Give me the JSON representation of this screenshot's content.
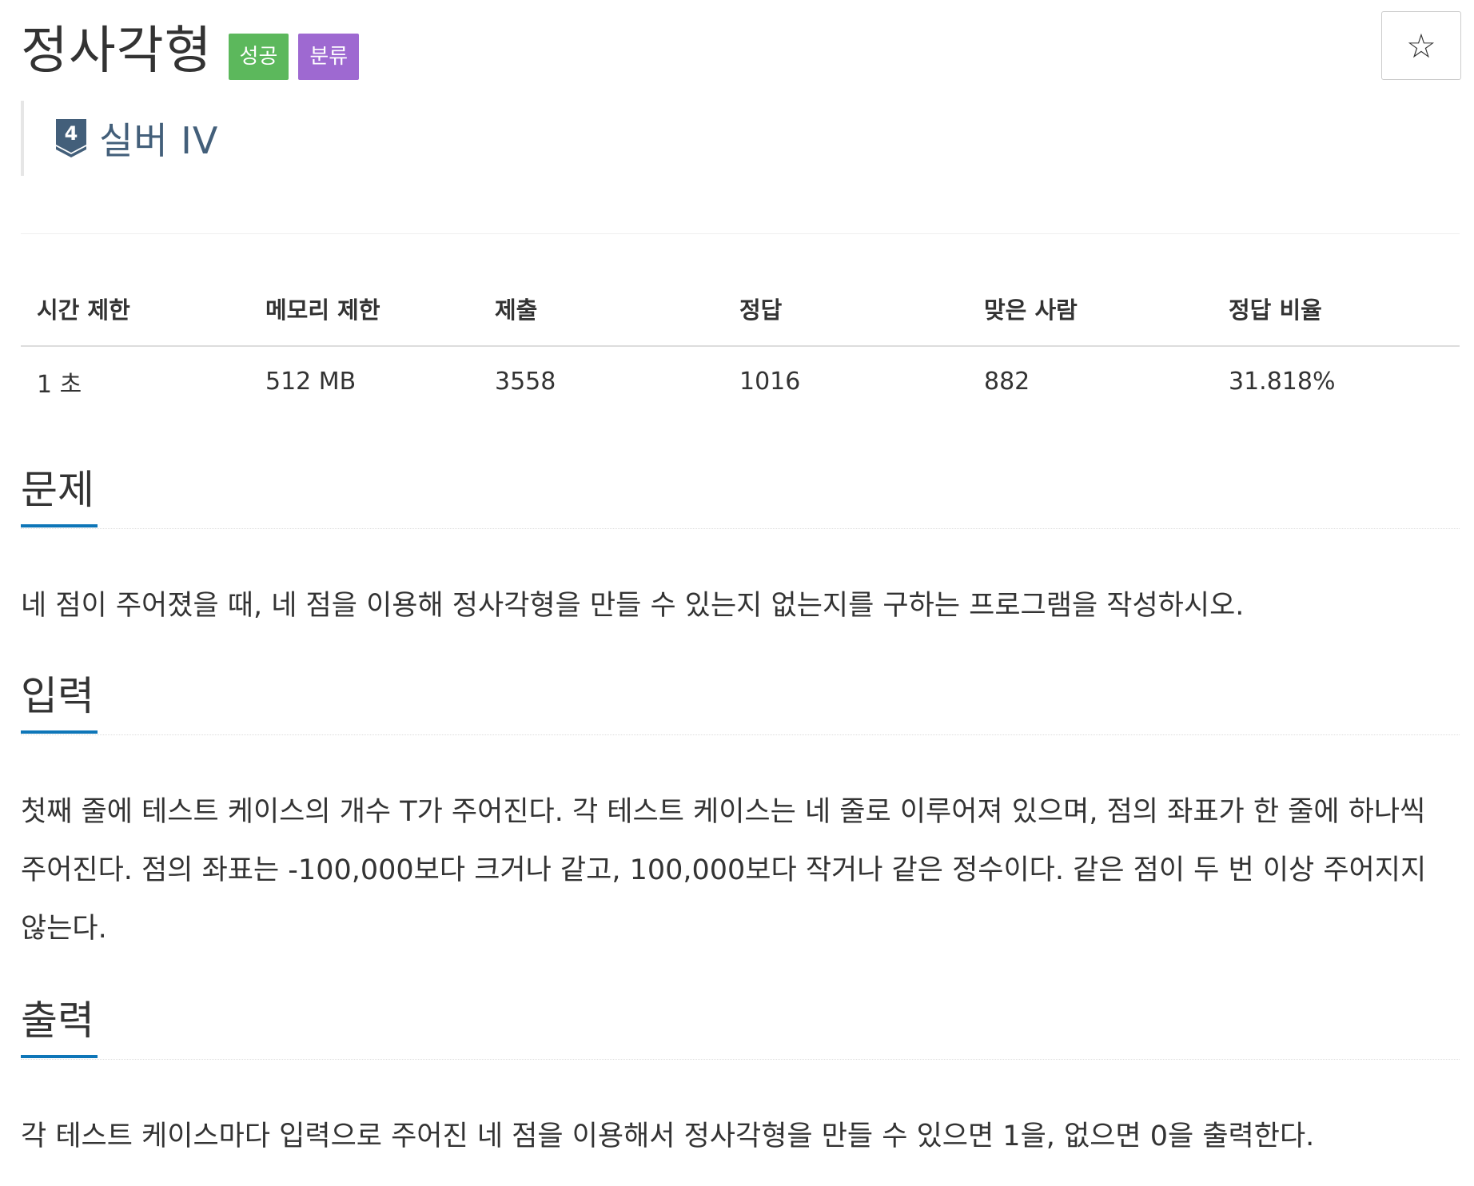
{
  "problem": {
    "title": "정사각형",
    "badges": {
      "success": "성공",
      "category": "분류"
    },
    "star_icon": "☆",
    "tier": {
      "icon": "silver-tier-shield-icon",
      "icon_number": "4",
      "label": "실버 IV"
    }
  },
  "info_table": {
    "headers": [
      "시간 제한",
      "메모리 제한",
      "제출",
      "정답",
      "맞은 사람",
      "정답 비율"
    ],
    "values": [
      "1 초",
      "512 MB",
      "3558",
      "1016",
      "882",
      "31.818%"
    ]
  },
  "sections": {
    "problem": {
      "title": "문제",
      "text": "네 점이 주어졌을 때, 네 점을 이용해 정사각형을 만들 수 있는지 없는지를 구하는 프로그램을 작성하시오."
    },
    "input": {
      "title": "입력",
      "text": "첫째 줄에 테스트 케이스의 개수 T가 주어진다. 각 테스트 케이스는 네 줄로 이루어져 있으며, 점의 좌표가 한 줄에 하나씩 주어진다. 점의 좌표는 -100,000보다 크거나 같고, 100,000보다 작거나 같은 정수이다. 같은 점이 두 번 이상 주어지지 않는다."
    },
    "output": {
      "title": "출력",
      "text": "각 테스트 케이스마다 입력으로 주어진 네 점을 이용해서 정사각형을 만들 수 있으면 1을, 없으면 0을 출력한다."
    }
  },
  "colors": {
    "success_badge": "#5cb85c",
    "category_badge": "#9e69d1",
    "tier_silver": "#435f7a",
    "section_underline": "#0e76b8"
  }
}
